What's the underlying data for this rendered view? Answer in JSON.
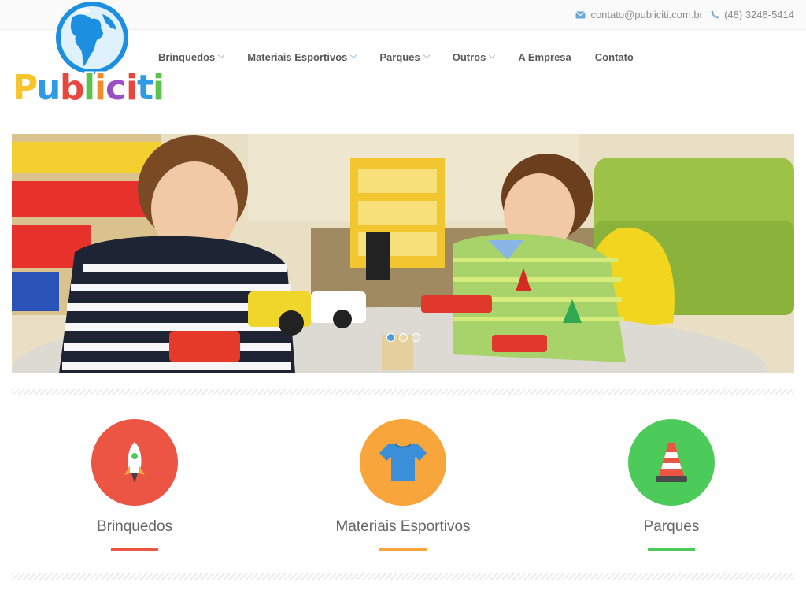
{
  "topbar": {
    "email": "contato@publiciti.com.br",
    "phone": "(48) 3248-5414",
    "email_icon": "envelope-icon",
    "phone_icon": "phone-icon",
    "icon_color": "#6fa7d6"
  },
  "logo": {
    "text": "Publiciti",
    "icon": "globe-icon"
  },
  "nav": {
    "items": [
      {
        "label": "Brinquedos",
        "dropdown": true
      },
      {
        "label": "Materiais Esportivos",
        "dropdown": true
      },
      {
        "label": "Parques",
        "dropdown": true
      },
      {
        "label": "Outros",
        "dropdown": true
      },
      {
        "label": "A Empresa",
        "dropdown": false
      },
      {
        "label": "Contato",
        "dropdown": false
      }
    ]
  },
  "slider": {
    "slides": 3,
    "active": 1
  },
  "features": [
    {
      "title": "Brinquedos",
      "color": "#ec5443",
      "icon": "rocket-icon"
    },
    {
      "title": "Materiais Esportivos",
      "color": "#f8a63b",
      "icon": "tshirt-icon"
    },
    {
      "title": "Parques",
      "color": "#4dcb5a",
      "icon": "traffic-cone-icon"
    }
  ]
}
